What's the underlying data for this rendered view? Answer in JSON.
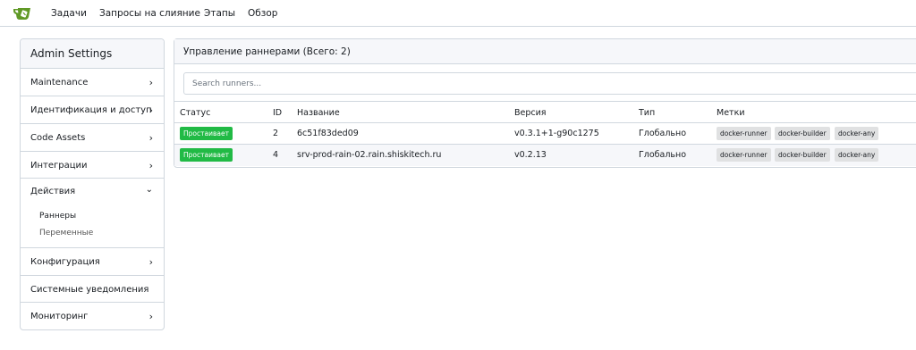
{
  "nav": {
    "logo": "gitea-logo",
    "items": [
      "Задачи",
      "Запросы на слияние",
      "Этапы",
      "Обзор"
    ]
  },
  "sidebar": {
    "title": "Admin Settings",
    "items": [
      {
        "label": "Maintenance"
      },
      {
        "label": "Идентификация и доступ"
      },
      {
        "label": "Code Assets"
      },
      {
        "label": "Интеграции"
      },
      {
        "label": "Действия",
        "expanded": true,
        "children": [
          "Раннеры",
          "Переменные"
        ]
      },
      {
        "label": "Конфигурация"
      },
      {
        "label": "Системные уведомления"
      },
      {
        "label": "Мониторинг"
      }
    ]
  },
  "panel": {
    "title": "Управление раннерами (Всего: 2)",
    "search_placeholder": "Search runners..."
  },
  "table": {
    "headers": [
      "Статус",
      "ID",
      "Название",
      "Версия",
      "Тип",
      "Метки"
    ],
    "rows": [
      {
        "status": "Простаивает",
        "id": "2",
        "name": "6c51f83ded09",
        "version": "v0.3.1+1-g90c1275",
        "type": "Глобально",
        "labels": [
          "docker-runner",
          "docker-builder",
          "docker-any"
        ]
      },
      {
        "status": "Простаивает",
        "id": "4",
        "name": "srv-prod-rain-02.rain.shiskitech.ru",
        "version": "v0.2.13",
        "type": "Глобально",
        "labels": [
          "docker-runner",
          "docker-builder",
          "docker-any"
        ]
      }
    ]
  },
  "colors": {
    "status_idle": "#21ba45",
    "label_bg": "#e0e1e2",
    "header_bg": "#f6f7fa",
    "border": "#d0d7de"
  }
}
